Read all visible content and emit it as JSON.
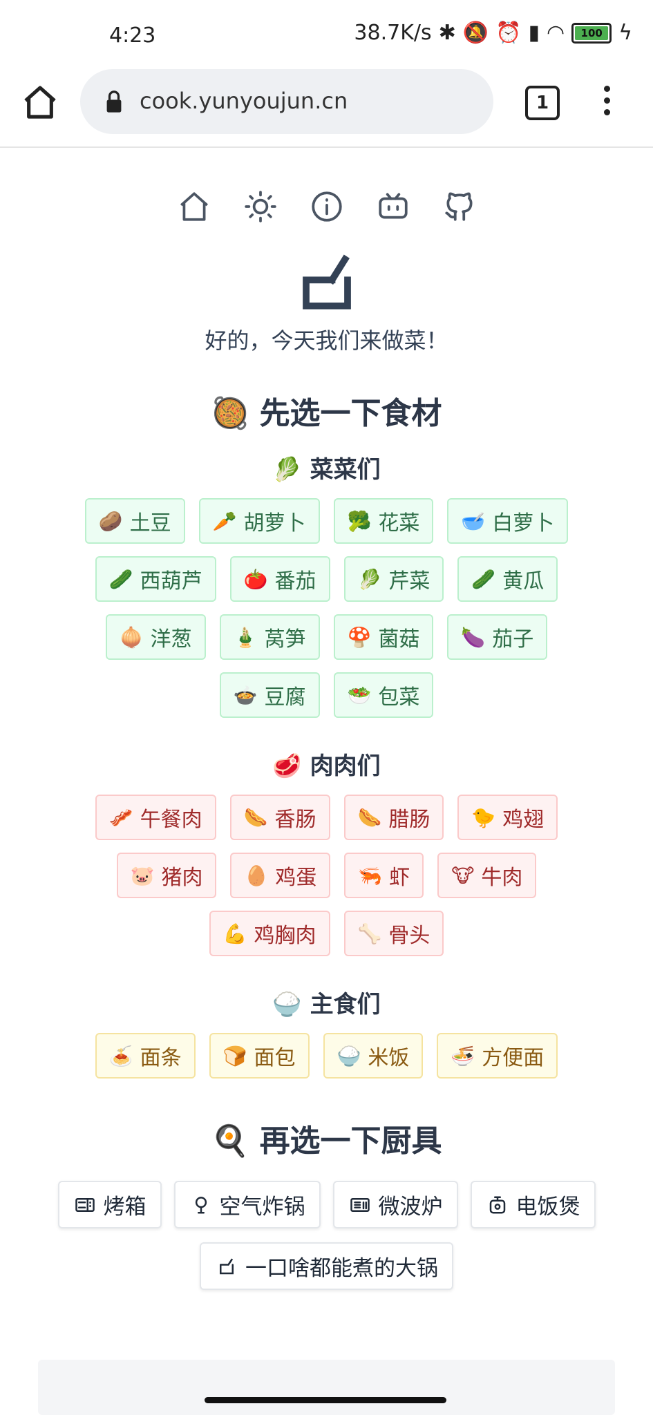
{
  "status_bar": {
    "time": "4:23",
    "network_speed": "38.7K/s",
    "battery": "100"
  },
  "browser": {
    "url": "cook.yunyoujun.cn",
    "tab_count": "1"
  },
  "tagline": "好的，今天我们来做菜！",
  "ingredients_section": {
    "icon": "🥘",
    "title": "先选一下食材"
  },
  "vegetables": {
    "icon": "🥬",
    "title": "菜菜们",
    "items": [
      {
        "emoji": "🥔",
        "label": "土豆"
      },
      {
        "emoji": "🥕",
        "label": "胡萝卜"
      },
      {
        "emoji": "🥦",
        "label": "花菜"
      },
      {
        "emoji": "🥣",
        "label": "白萝卜"
      },
      {
        "emoji": "🥒",
        "label": "西葫芦"
      },
      {
        "emoji": "🍅",
        "label": "番茄"
      },
      {
        "emoji": "🥬",
        "label": "芹菜"
      },
      {
        "emoji": "🥒",
        "label": "黄瓜"
      },
      {
        "emoji": "🧅",
        "label": "洋葱"
      },
      {
        "emoji": "🎍",
        "label": "莴笋"
      },
      {
        "emoji": "🍄",
        "label": "菌菇"
      },
      {
        "emoji": "🍆",
        "label": "茄子"
      },
      {
        "emoji": "🍲",
        "label": "豆腐"
      },
      {
        "emoji": "🥗",
        "label": "包菜"
      }
    ]
  },
  "meats": {
    "icon": "🥩",
    "title": "肉肉们",
    "items": [
      {
        "emoji": "🥓",
        "label": "午餐肉"
      },
      {
        "emoji": "🌭",
        "label": "香肠"
      },
      {
        "emoji": "🌭",
        "label": "腊肠"
      },
      {
        "emoji": "🐤",
        "label": "鸡翅"
      },
      {
        "emoji": "🐷",
        "label": "猪肉"
      },
      {
        "emoji": "🥚",
        "label": "鸡蛋"
      },
      {
        "emoji": "🦐",
        "label": "虾"
      },
      {
        "emoji": "🐮",
        "label": "牛肉"
      },
      {
        "emoji": "💪",
        "label": "鸡胸肉"
      },
      {
        "emoji": "🦴",
        "label": "骨头"
      }
    ]
  },
  "staples": {
    "icon": "🍚",
    "title": "主食们",
    "items": [
      {
        "emoji": "🍝",
        "label": "面条"
      },
      {
        "emoji": "🍞",
        "label": "面包"
      },
      {
        "emoji": "🍚",
        "label": "米饭"
      },
      {
        "emoji": "🍜",
        "label": "方便面"
      }
    ]
  },
  "tools_section": {
    "icon": "🍳",
    "title": "再选一下厨具",
    "items": [
      {
        "icon": "oven-icon",
        "label": "烤箱"
      },
      {
        "icon": "air-fryer-icon",
        "label": "空气炸锅"
      },
      {
        "icon": "microwave-icon",
        "label": "微波炉"
      },
      {
        "icon": "rice-cooker-icon",
        "label": "电饭煲"
      },
      {
        "icon": "pot-icon",
        "label": "一口啥都能煮的大锅"
      }
    ]
  }
}
